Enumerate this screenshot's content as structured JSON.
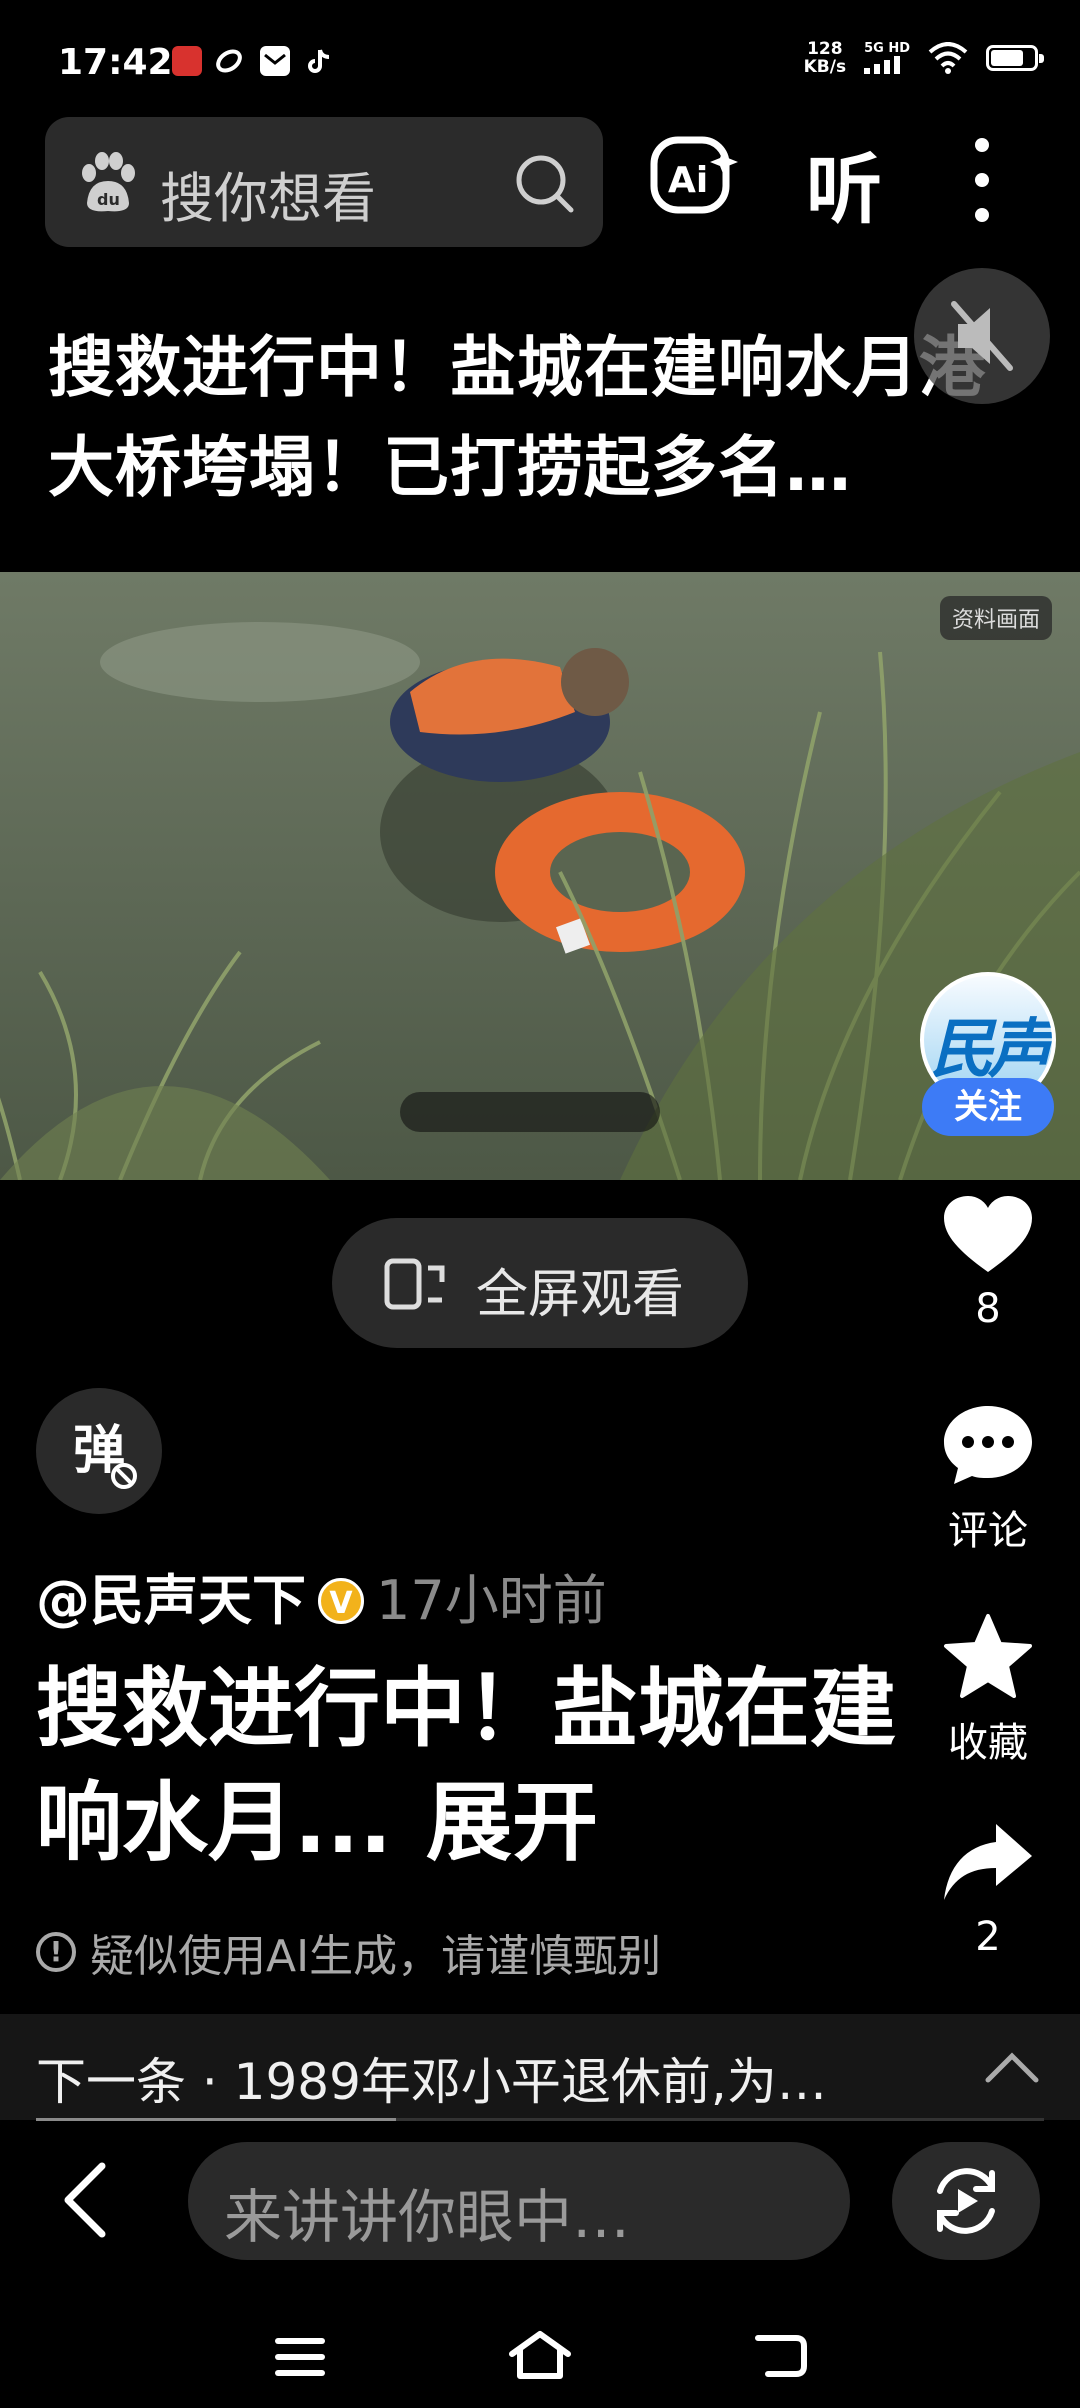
{
  "status_bar": {
    "time": "17:42",
    "speed_value": "128",
    "speed_unit": "KB/s",
    "network": "5G HD",
    "battery_level": 0.7
  },
  "header": {
    "search_placeholder": "搜你想看",
    "ai_label": "Ai",
    "listen_label": "听"
  },
  "video": {
    "title": "搜救进行中！盐城在建响水月港大桥垮塌！已打捞起多名…",
    "archive_badge": "资料画面",
    "fullscreen_label": "全屏观看"
  },
  "author": {
    "avatar_text": "民声",
    "follow_label": "关注",
    "handle": "@民声天下",
    "time_ago": "17小时前"
  },
  "actions": {
    "likes": "8",
    "comment_label": "评论",
    "favorite_label": "收藏",
    "shares": "2"
  },
  "danmaku_label": "弹",
  "description": {
    "text": "搜救进行中！盐城在建响水月...",
    "expand_label": "展开"
  },
  "ai_warning": "疑似使用AI生成，请谨慎甄别",
  "next": {
    "text": "下一条 · 1989年邓小平退休前,为…"
  },
  "comment_input": {
    "placeholder": "来讲讲你眼中…"
  },
  "colors": {
    "background": "#000000",
    "follow_blue": "#3d7bf6",
    "verified_gold": "#f2b21b",
    "pill_gray": "#2a2a2a"
  }
}
